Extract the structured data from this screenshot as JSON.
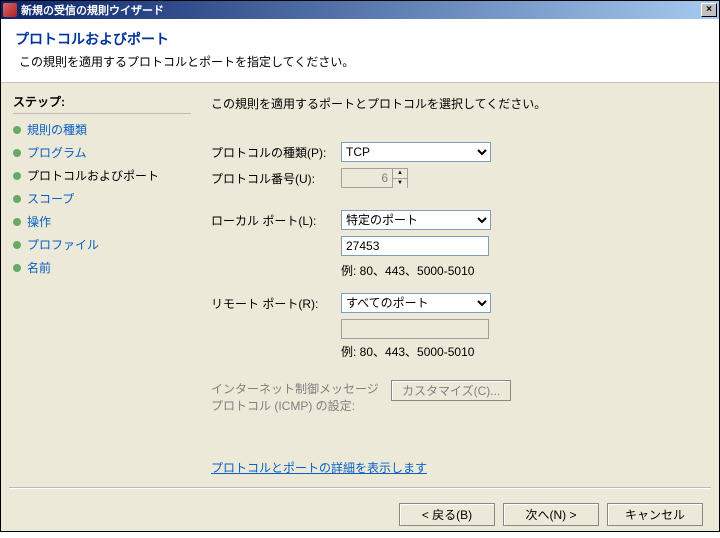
{
  "window": {
    "title": "新規の受信の規則ウイザード"
  },
  "header": {
    "title": "プロトコルおよびポート",
    "subtitle": "この規則を適用するプロトコルとポートを指定してください。"
  },
  "sidebar": {
    "heading": "ステップ:",
    "items": [
      {
        "label": "規則の種類"
      },
      {
        "label": "プログラム"
      },
      {
        "label": "プロトコルおよびポート"
      },
      {
        "label": "スコープ"
      },
      {
        "label": "操作"
      },
      {
        "label": "プロファイル"
      },
      {
        "label": "名前"
      }
    ]
  },
  "main": {
    "heading": "この規則を適用するポートとプロトコルを選択してください。",
    "protocol_type_label": "プロトコルの種類(P):",
    "protocol_type_value": "TCP",
    "protocol_number_label": "プロトコル番号(U):",
    "protocol_number_value": "6",
    "local_port_label": "ローカル ポート(L):",
    "local_port_selection": "特定のポート",
    "local_port_value": "27453",
    "local_port_example": "例: 80、443、5000-5010",
    "remote_port_label": "リモート ポート(R):",
    "remote_port_selection": "すべてのポート",
    "remote_port_example": "例: 80、443、5000-5010",
    "icmp_label": "インターネット制御メッセージ プロトコル (ICMP) の設定:",
    "customize_button": "カスタマイズ(C)...",
    "learn_link": "プロトコルとポートの詳細を表示します"
  },
  "footer": {
    "back": "< 戻る(B)",
    "next": "次へ(N) >",
    "cancel": "キャンセル"
  }
}
